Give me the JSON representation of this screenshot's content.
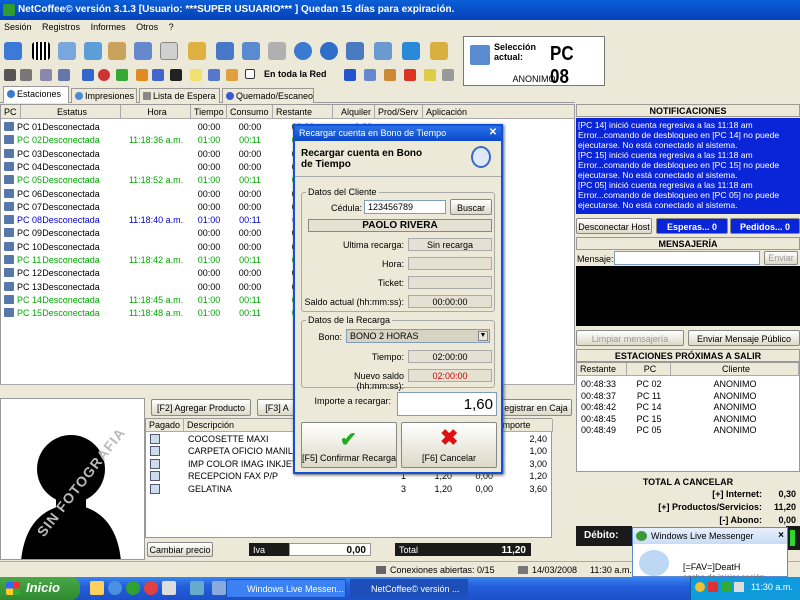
{
  "window": {
    "title": "NetCoffee© versión  3.1.3   [Usuario: ***SUPER USUARIO*** ]   Quedan 15 días para expiración."
  },
  "menu": [
    "Sesión",
    "Registros",
    "Informes",
    "Otros",
    "?"
  ],
  "toolbar": {
    "network_label": "En toda la Red"
  },
  "selection": {
    "label_line1": "Selección",
    "label_line2": "actual:",
    "pc": "PC 08",
    "user": "ANONIMO"
  },
  "tabs": [
    "Estaciones",
    "Impresiones",
    "Lista de Espera",
    "Quemado/Escaneo"
  ],
  "grid": {
    "columns": [
      "PC",
      "Estatus",
      "Hora",
      "Tiempo",
      "Consumo",
      "Restante",
      "Alquiler",
      "Prod/Serv",
      "Aplicación"
    ],
    "rows": [
      {
        "pc": "PC 01",
        "status": "Desconectada",
        "hora": "",
        "tiempo": "00:00",
        "consumo": "00:00",
        "restante": "00:00",
        "alquiler": "0,00",
        "color": "#000000"
      },
      {
        "pc": "PC 02",
        "status": "Desconectada",
        "hora": "11:18:36 a.m.",
        "tiempo": "01:00",
        "consumo": "00:11",
        "restante": "00:49",
        "alquiler": "",
        "color": "#00aa00"
      },
      {
        "pc": "PC 03",
        "status": "Desconectada",
        "hora": "",
        "tiempo": "00:00",
        "consumo": "00:00",
        "restante": "00:00",
        "alquiler": "",
        "color": "#000000"
      },
      {
        "pc": "PC 04",
        "status": "Desconectada",
        "hora": "",
        "tiempo": "00:00",
        "consumo": "00:00",
        "restante": "00:00",
        "alquiler": "",
        "color": "#000000"
      },
      {
        "pc": "PC 05",
        "status": "Desconectada",
        "hora": "11:18:52 a.m.",
        "tiempo": "01:00",
        "consumo": "00:11",
        "restante": "00:49",
        "alquiler": "",
        "color": "#00aa00"
      },
      {
        "pc": "PC 06",
        "status": "Desconectada",
        "hora": "",
        "tiempo": "00:00",
        "consumo": "00:00",
        "restante": "00:00",
        "alquiler": "",
        "color": "#000000"
      },
      {
        "pc": "PC 07",
        "status": "Desconectada",
        "hora": "",
        "tiempo": "00:00",
        "consumo": "00:00",
        "restante": "00:00",
        "alquiler": "",
        "color": "#000000"
      },
      {
        "pc": "PC 08",
        "status": "Desconectada",
        "hora": "11:18:40 a.m.",
        "tiempo": "01:00",
        "consumo": "00:11",
        "restante": "00:11",
        "alquiler": "",
        "color": "#0000cc"
      },
      {
        "pc": "PC 09",
        "status": "Desconectada",
        "hora": "",
        "tiempo": "00:00",
        "consumo": "00:00",
        "restante": "00:00",
        "alquiler": "",
        "color": "#000000"
      },
      {
        "pc": "PC 10",
        "status": "Desconectada",
        "hora": "",
        "tiempo": "00:00",
        "consumo": "00:00",
        "restante": "00:00",
        "alquiler": "",
        "color": "#000000"
      },
      {
        "pc": "PC 11",
        "status": "Desconectada",
        "hora": "11:18:42 a.m.",
        "tiempo": "01:00",
        "consumo": "00:11",
        "restante": "00:49",
        "alquiler": "",
        "color": "#00aa00"
      },
      {
        "pc": "PC 12",
        "status": "Desconectada",
        "hora": "",
        "tiempo": "00:00",
        "consumo": "00:00",
        "restante": "00:00",
        "alquiler": "",
        "color": "#000000"
      },
      {
        "pc": "PC 13",
        "status": "Desconectada",
        "hora": "",
        "tiempo": "00:00",
        "consumo": "00:00",
        "restante": "00:00",
        "alquiler": "",
        "color": "#000000"
      },
      {
        "pc": "PC 14",
        "status": "Desconectada",
        "hora": "11:18:45 a.m.",
        "tiempo": "01:00",
        "consumo": "00:11",
        "restante": "00:49",
        "alquiler": "",
        "color": "#00aa00"
      },
      {
        "pc": "PC 15",
        "status": "Desconectada",
        "hora": "11:18:48 a.m.",
        "tiempo": "01:00",
        "consumo": "00:11",
        "restante": "00:49",
        "alquiler": "",
        "color": "#00aa00"
      }
    ]
  },
  "photo": {
    "watermark": "SIN FOTOGRAFIA"
  },
  "products": {
    "buttons": [
      "[F2] Agregar Producto",
      "[F3] A",
      "egistrar en Caja"
    ],
    "columns": [
      "Pagado",
      "Descripción",
      "",
      "",
      "",
      "Importe"
    ],
    "rows": [
      {
        "desc": "COCOSETTE MAXI",
        "qty": "",
        "price": "",
        "disc": "",
        "importe": "2,40"
      },
      {
        "desc": "CARPETA OFICIO MANILA",
        "qty": "",
        "price": "",
        "disc": "",
        "importe": "1,00"
      },
      {
        "desc": "IMP COLOR IMAG INKJET",
        "qty": "",
        "price": "",
        "disc": "",
        "importe": "3,00"
      },
      {
        "desc": "RECEPCION FAX P/P",
        "qty": "1",
        "price": "1,20",
        "disc": "0,00",
        "importe": "1,20"
      },
      {
        "desc": "GELATINA",
        "qty": "3",
        "price": "1,20",
        "disc": "0,00",
        "importe": "3,60"
      }
    ],
    "change_price": "Cambiar precio",
    "iva_label": "Iva",
    "iva_value": "0,00",
    "total_label": "Total",
    "total_value": "11,20"
  },
  "notifications": {
    "title": "NOTIFICACIONES",
    "lines": [
      "[PC 14] inició cuenta regresiva a las 11:18 am",
      "Error...comando de desbloqueo en [PC 14] no puede ejecutarse. No está conectado al sistema.",
      "[PC 15] inició cuenta regresiva a las 11:18 am",
      "Error...comando de desbloqueo en [PC 15] no puede ejecutarse. No está conectado al sistema.",
      "[PC 05] inició cuenta regresiva a las 11:18 am",
      "Error...comando de desbloqueo en [PC 05] no puede ejecutarse. No está conectado al sistema."
    ],
    "disconnect": "Desconectar Host",
    "waits": "Esperas... 0",
    "orders": "Pedidos... 0"
  },
  "messaging": {
    "title": "MENSAJERÍA",
    "label": "Mensaje:",
    "send": "Enviar",
    "clear": "Limpiar mensajería",
    "public": "Enviar Mensaje Público"
  },
  "next": {
    "title": "ESTACIONES PRÓXIMAS A SALIR",
    "columns": [
      "Restante",
      "PC",
      "Cliente"
    ],
    "rows": [
      {
        "rest": "00:48:33",
        "pc": "PC 02",
        "client": "ANONIMO"
      },
      {
        "rest": "00:48:37",
        "pc": "PC 11",
        "client": "ANONIMO"
      },
      {
        "rest": "00:48:42",
        "pc": "PC 14",
        "client": "ANONIMO"
      },
      {
        "rest": "00:48:45",
        "pc": "PC 15",
        "client": "ANONIMO"
      },
      {
        "rest": "00:48:49",
        "pc": "PC 05",
        "client": "ANONIMO"
      }
    ]
  },
  "totals": {
    "title": "TOTAL A CANCELAR",
    "internet_label": "[+] Internet:",
    "internet": "0,30",
    "products_label": "[+] Productos/Servicios:",
    "products": "11,20",
    "abono_label": "[-] Abono:",
    "abono": "0,00",
    "debito": "Débito:"
  },
  "dialog": {
    "title": "Recargar cuenta en Bono de Tiempo",
    "header": "Recargar cuenta en Bono de Tiempo",
    "client_group": "Datos del Cliente",
    "cedula_label": "Cédula:",
    "cedula": "123456789",
    "search": "Buscar",
    "name": "PAOLO RIVERA",
    "last_label": "Ultima recarga:",
    "last": "Sin recarga",
    "hora_label": "Hora:",
    "ticket_label": "Ticket:",
    "saldo_label": "Saldo actual (hh:mm:ss):",
    "saldo": "00:00:00",
    "recharge_group": "Datos de la Recarga",
    "bono_label": "Bono:",
    "bono": "BONO 2 HORAS",
    "tiempo_label": "Tiempo:",
    "tiempo": "02:00:00",
    "nuevo_label": "Nuevo saldo (hh:mm:ss):",
    "nuevo": "02:00:00",
    "importe_label": "Importe a recargar:",
    "importe": "1,60",
    "confirm": "[F5] Confirmar Recarga",
    "cancel": "[F6] Cancelar"
  },
  "status": {
    "connections": "Conexiones abiertas: 0/15",
    "date": "14/03/2008",
    "time": "11:30 a.m."
  },
  "msn": {
    "title": "Windows Live Messenger",
    "line1": "[=FAV=]DeatH",
    "line2": "acaba de iniciar sesión"
  },
  "taskbar": {
    "start": "Inicio",
    "items": [
      "Windows Live Messen...",
      "NetCoffee© versión ..."
    ],
    "clock": "11:30 a.m."
  }
}
